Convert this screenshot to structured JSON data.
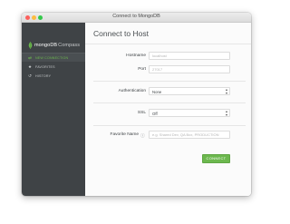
{
  "window": {
    "title": "Connect to MongoDB"
  },
  "sidebar": {
    "logo": {
      "brand": "mongoDB",
      "product": "Compass"
    },
    "items": [
      {
        "label": "NEW CONNECTION",
        "icon": "connection-icon",
        "active": true
      },
      {
        "label": "FAVORITES",
        "icon": "star-icon",
        "active": false
      },
      {
        "label": "HISTORY",
        "icon": "history-icon",
        "active": false
      }
    ]
  },
  "main": {
    "title": "Connect to Host",
    "hostname": {
      "label": "Hostname",
      "placeholder": "localhost",
      "value": ""
    },
    "port": {
      "label": "Port",
      "placeholder": "27017",
      "value": ""
    },
    "authentication": {
      "label": "Authentication",
      "selected": "None"
    },
    "ssl": {
      "label": "SSL",
      "selected": "Off"
    },
    "favorite_name": {
      "label": "Favorite Name",
      "placeholder": "e.g. Shared Dev, QA Box, PRODUCTION",
      "value": "",
      "icon": "info-icon"
    },
    "connect_button": {
      "label": "CONNECT"
    }
  },
  "colors": {
    "sidebar_bg": "#3f4346",
    "accent_green": "#6cb84e",
    "title_text": "#4a4f52"
  }
}
